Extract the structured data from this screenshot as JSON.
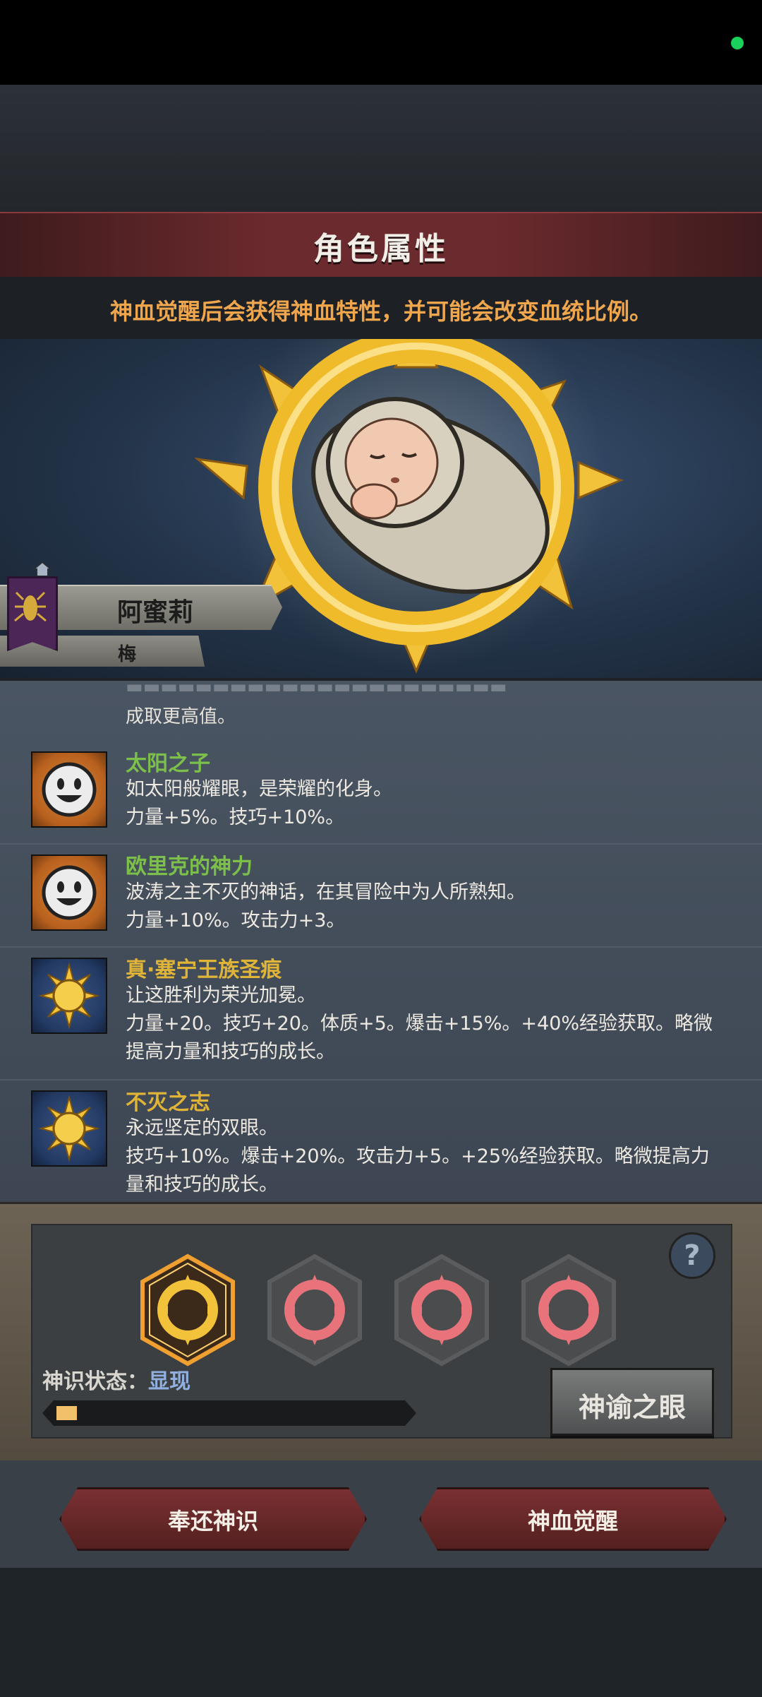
{
  "header": {
    "title": "角色属性"
  },
  "hint": "神血觉醒后会获得神血特性，并可能会改变血统比例。",
  "character": {
    "name": "阿蜜莉",
    "subtitle": "梅"
  },
  "list": {
    "partial_top_line": "成取更高值。",
    "traits": [
      {
        "name": "太阳之子",
        "name_color": "#7cc04b",
        "icon": "smile-icon",
        "desc1": "如太阳般耀眼，是荣耀的化身。",
        "desc2": "力量+5%。技巧+10%。"
      },
      {
        "name": "欧里克的神力",
        "name_color": "#7cc04b",
        "icon": "smile-icon",
        "desc1": "波涛之主不灭的神话，在其冒险中为人所熟知。",
        "desc2": "力量+10%。攻击力+3。"
      },
      {
        "name": "真·塞宁王族圣痕",
        "name_color": "#e0b437",
        "icon": "sun-icon",
        "desc1": "让这胜利为荣光加冕。",
        "desc2": "力量+20。技巧+20。体质+5。爆击+15%。+40%经验获取。略微提高力量和技巧的成长。"
      },
      {
        "name": "不灭之志",
        "name_color": "#e0b437",
        "icon": "sun-icon",
        "desc1": "永远坚定的双眼。",
        "desc2": "技巧+10%。爆击+20%。攻击力+5。+25%经验获取。略微提高力量和技巧的成长。"
      }
    ]
  },
  "divine": {
    "status_label": "神识状态：",
    "status_value": "显现",
    "progress": 0.06,
    "help_label": "?",
    "oracle_button": "神谕之眼",
    "slots": [
      {
        "active": true,
        "icon": "sun-ring-icon"
      },
      {
        "active": false,
        "icon": "sun-ring-icon"
      },
      {
        "active": false,
        "icon": "sun-ring-icon"
      },
      {
        "active": false,
        "icon": "sun-ring-icon"
      }
    ]
  },
  "actions": {
    "return_button": "奉还神识",
    "awaken_button": "神血觉醒"
  }
}
